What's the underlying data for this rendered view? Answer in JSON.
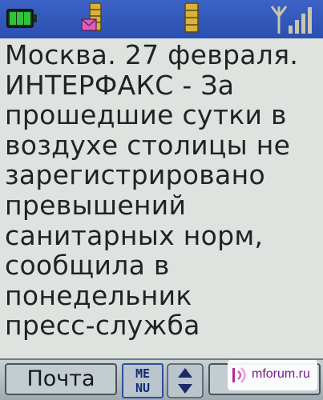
{
  "status_bar": {
    "icons": [
      "battery-icon",
      "mail-storage-icon",
      "memory-storage-icon",
      "signal-strength-icon"
    ],
    "colors": {
      "bar": "#2f55b8",
      "battery": "#2fae2f",
      "storage": "#d8b23a",
      "signal": "#c8c8b0"
    }
  },
  "message": {
    "lines": [
      "Москва. 27 февраля.",
      "ИНТЕРФАКС - За",
      "прошедшие сутки в",
      "воздухе столицы не",
      "зарегистрировано",
      "превышений",
      "санитарных норм,",
      "сообщила в",
      "понедельник",
      "пресс-служба"
    ],
    "text_color": "#1e2424"
  },
  "softkeys": {
    "left_label": "Почта",
    "menu_label_top": "ME",
    "menu_label_bottom": "NU",
    "nav_icon": "up-down-arrows-icon"
  },
  "watermark": {
    "text": "mforum.ru",
    "logo_icon": "mforum-logo-icon"
  }
}
